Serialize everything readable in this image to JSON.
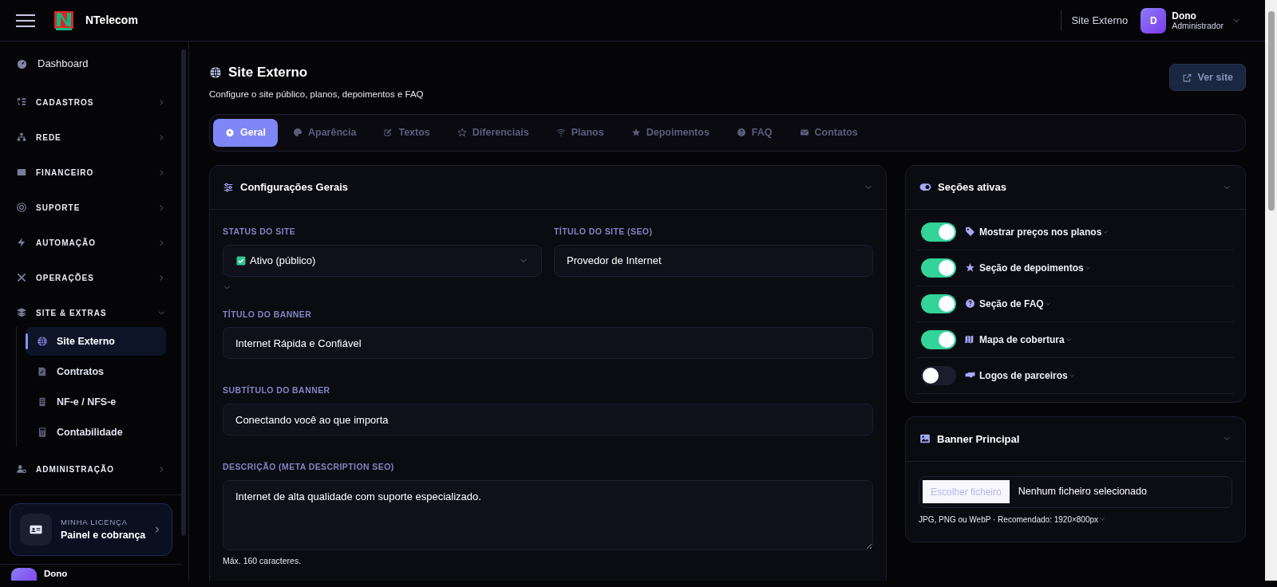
{
  "header": {
    "app_name": "NTelecom",
    "breadcrumb": "Site Externo",
    "user": {
      "initial": "D",
      "name": "Dono",
      "role": "Administrador"
    }
  },
  "sidebar": {
    "items": [
      {
        "kind": "link",
        "label": "Dashboard"
      },
      {
        "kind": "group",
        "label": "CADASTROS",
        "expanded": false
      },
      {
        "kind": "group",
        "label": "REDE",
        "expanded": false
      },
      {
        "kind": "group",
        "label": "FINANCEIRO",
        "expanded": false
      },
      {
        "kind": "group",
        "label": "SUPORTE",
        "expanded": false
      },
      {
        "kind": "group",
        "label": "AUTOMAÇÃO",
        "expanded": false
      },
      {
        "kind": "group",
        "label": "OPERAÇÕES",
        "expanded": false
      },
      {
        "kind": "group",
        "label": "SITE & EXTRAS",
        "expanded": true,
        "children": [
          {
            "label": "Site Externo",
            "selected": true
          },
          {
            "label": "Contratos",
            "selected": false
          },
          {
            "label": "NF-e / NFS-e",
            "selected": false
          },
          {
            "label": "Contabilidade",
            "selected": false
          }
        ]
      },
      {
        "kind": "group",
        "label": "ADMINISTRAÇÃO",
        "expanded": false
      }
    ],
    "license": {
      "caption": "MINHA LICENÇA",
      "title": "Painel e cobrança"
    },
    "user": {
      "name": "Dono"
    }
  },
  "page": {
    "title": "Site Externo",
    "subtitle": "Configure o site público, planos, depoimentos e FAQ",
    "action": "Ver site"
  },
  "tabs": [
    {
      "label": "Geral",
      "selected": true
    },
    {
      "label": "Aparência",
      "selected": false
    },
    {
      "label": "Textos",
      "selected": false
    },
    {
      "label": "Diferenciais",
      "selected": false
    },
    {
      "label": "Planos",
      "selected": false
    },
    {
      "label": "Depoimentos",
      "selected": false
    },
    {
      "label": "FAQ",
      "selected": false
    },
    {
      "label": "Contatos",
      "selected": false
    }
  ],
  "general": {
    "title": "Configurações Gerais",
    "fields": [
      {
        "kind": "select",
        "label": "STATUS DO SITE",
        "value": "Ativo (público)"
      },
      {
        "kind": "text",
        "label": "TÍTULO DO SITE (SEO)",
        "value": "Provedor de Internet"
      },
      {
        "kind": "text",
        "label": "TÍTULO DO BANNER",
        "value": "Internet Rápida e Confiável"
      },
      {
        "kind": "text",
        "label": "SUBTÍTULO DO BANNER",
        "value": "Conectando você ao que importa"
      },
      {
        "kind": "textarea",
        "label": "DESCRIÇÃO (META DESCRIPTION SEO)",
        "value": "Internet de alta qualidade com suporte especializado.",
        "hint": "Máx. 160 caracteres."
      }
    ]
  },
  "sections": {
    "title": "Seções ativas",
    "items": [
      {
        "label": "Mostrar preços nos planos",
        "on": true
      },
      {
        "label": "Seção de depoimentos",
        "on": true
      },
      {
        "label": "Seção de FAQ",
        "on": true
      },
      {
        "label": "Mapa de cobertura",
        "on": true
      },
      {
        "label": "Logos de parceiros",
        "on": false
      }
    ]
  },
  "banner": {
    "title": "Banner Principal",
    "file_button": "Escolher ficheiro",
    "file_status": "Nenhum ficheiro selecionado",
    "hint": "JPG, PNG ou WebP · Recomendado: 1920×800px"
  }
}
